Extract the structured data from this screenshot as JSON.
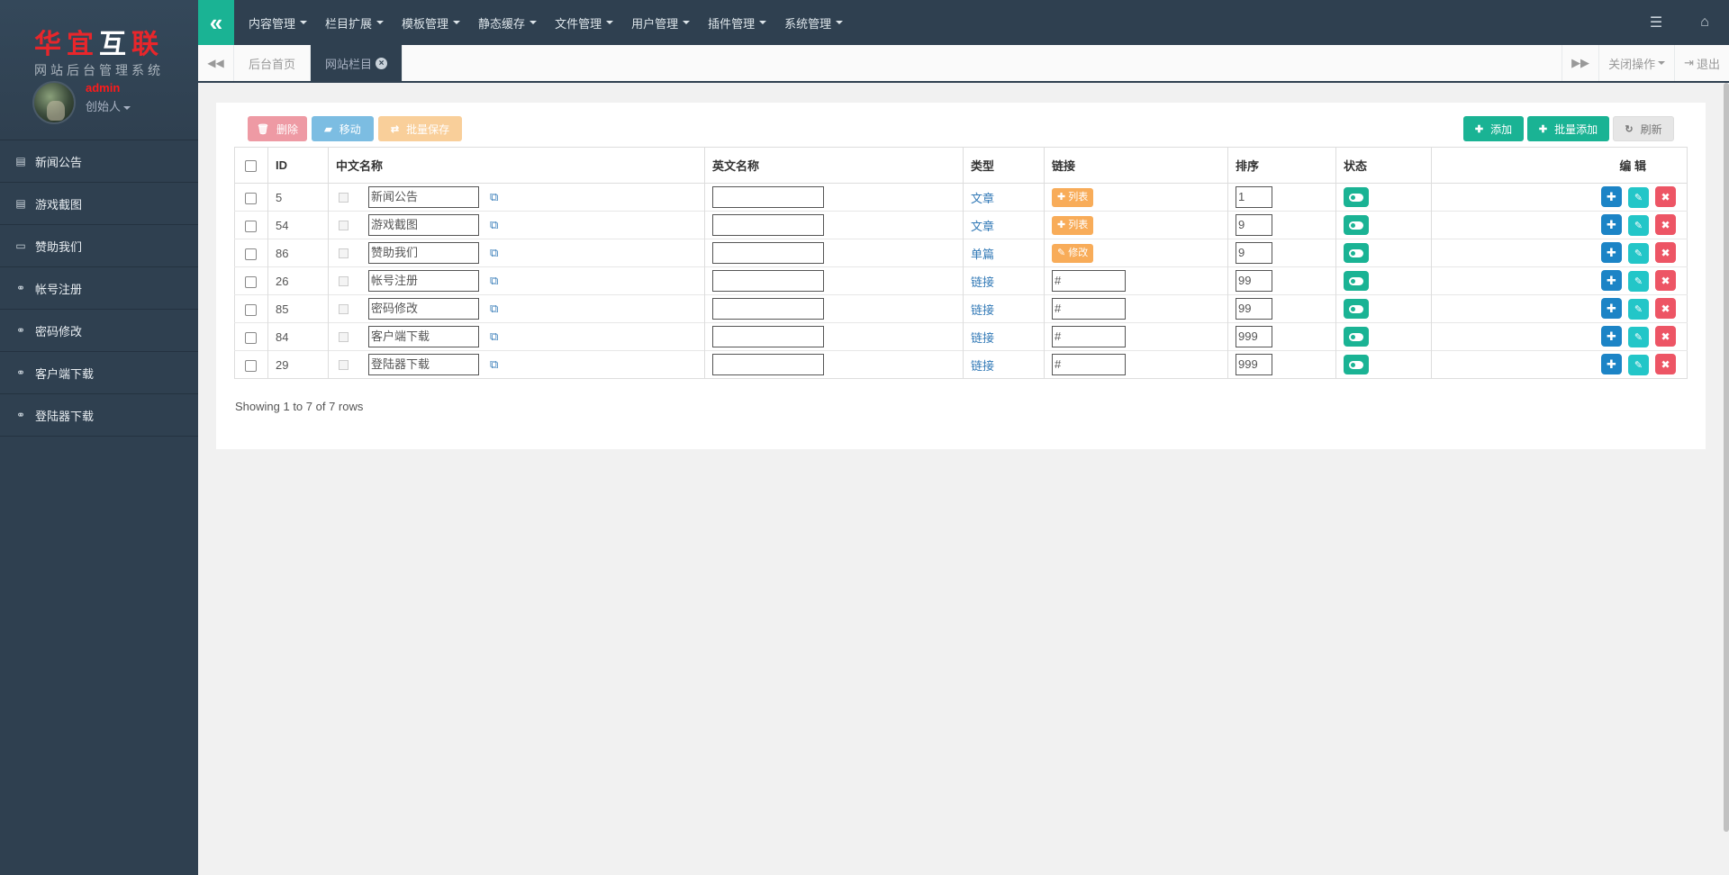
{
  "brand": {
    "logo_text": [
      "华",
      "宜",
      "互",
      "联"
    ],
    "subtitle": "网站后台管理系统"
  },
  "user": {
    "name": "admin",
    "role": "创始人"
  },
  "sidebar": {
    "items": [
      {
        "label": "新闻公告",
        "icon": "news-icon"
      },
      {
        "label": "游戏截图",
        "icon": "news-icon"
      },
      {
        "label": "赞助我们",
        "icon": "desktop-icon"
      },
      {
        "label": "帐号注册",
        "icon": "link-icon"
      },
      {
        "label": "密码修改",
        "icon": "link-icon"
      },
      {
        "label": "客户端下载",
        "icon": "link-icon"
      },
      {
        "label": "登陆器下载",
        "icon": "link-icon"
      }
    ]
  },
  "topnav": {
    "items": [
      "内容管理",
      "栏目扩展",
      "模板管理",
      "静态缓存",
      "文件管理",
      "用户管理",
      "插件管理",
      "系统管理"
    ]
  },
  "tabs": {
    "items": [
      {
        "label": "后台首页",
        "active": false
      },
      {
        "label": "网站栏目",
        "active": true
      }
    ],
    "close_ops": "关闭操作",
    "logout": "退出"
  },
  "toolbar": {
    "delete": "删除",
    "move": "移动",
    "batch_save": "批量保存",
    "add": "添加",
    "batch_add": "批量添加",
    "refresh": "刷新"
  },
  "table": {
    "headers": {
      "id": "ID",
      "cn_name": "中文名称",
      "en_name": "英文名称",
      "type": "类型",
      "link": "链接",
      "sort": "排序",
      "status": "状态",
      "edit": "编 辑"
    },
    "rows": [
      {
        "id": "5",
        "name": "新闻公告",
        "en": "",
        "type": "文章",
        "link_kind": "tag",
        "link_value": "列表",
        "sort": "1"
      },
      {
        "id": "54",
        "name": "游戏截图",
        "en": "",
        "type": "文章",
        "link_kind": "tag",
        "link_value": "列表",
        "sort": "9"
      },
      {
        "id": "86",
        "name": "赞助我们",
        "en": "",
        "type": "单篇",
        "link_kind": "tag",
        "link_value": "修改",
        "sort": "9"
      },
      {
        "id": "26",
        "name": "帐号注册",
        "en": "",
        "type": "链接",
        "link_kind": "input",
        "link_value": "#",
        "sort": "99"
      },
      {
        "id": "85",
        "name": "密码修改",
        "en": "",
        "type": "链接",
        "link_kind": "input",
        "link_value": "#",
        "sort": "99"
      },
      {
        "id": "84",
        "name": "客户端下载",
        "en": "",
        "type": "链接",
        "link_kind": "input",
        "link_value": "#",
        "sort": "999"
      },
      {
        "id": "29",
        "name": "登陆器下载",
        "en": "",
        "type": "链接",
        "link_kind": "input",
        "link_value": "#",
        "sort": "999"
      }
    ],
    "footer": "Showing 1 to 7 of 7 rows"
  },
  "colors": {
    "sidebar": "#2f4050",
    "accent": "#1ab394",
    "danger": "#ed5565",
    "primary": "#1c84c6",
    "warning": "#f8ac59"
  }
}
